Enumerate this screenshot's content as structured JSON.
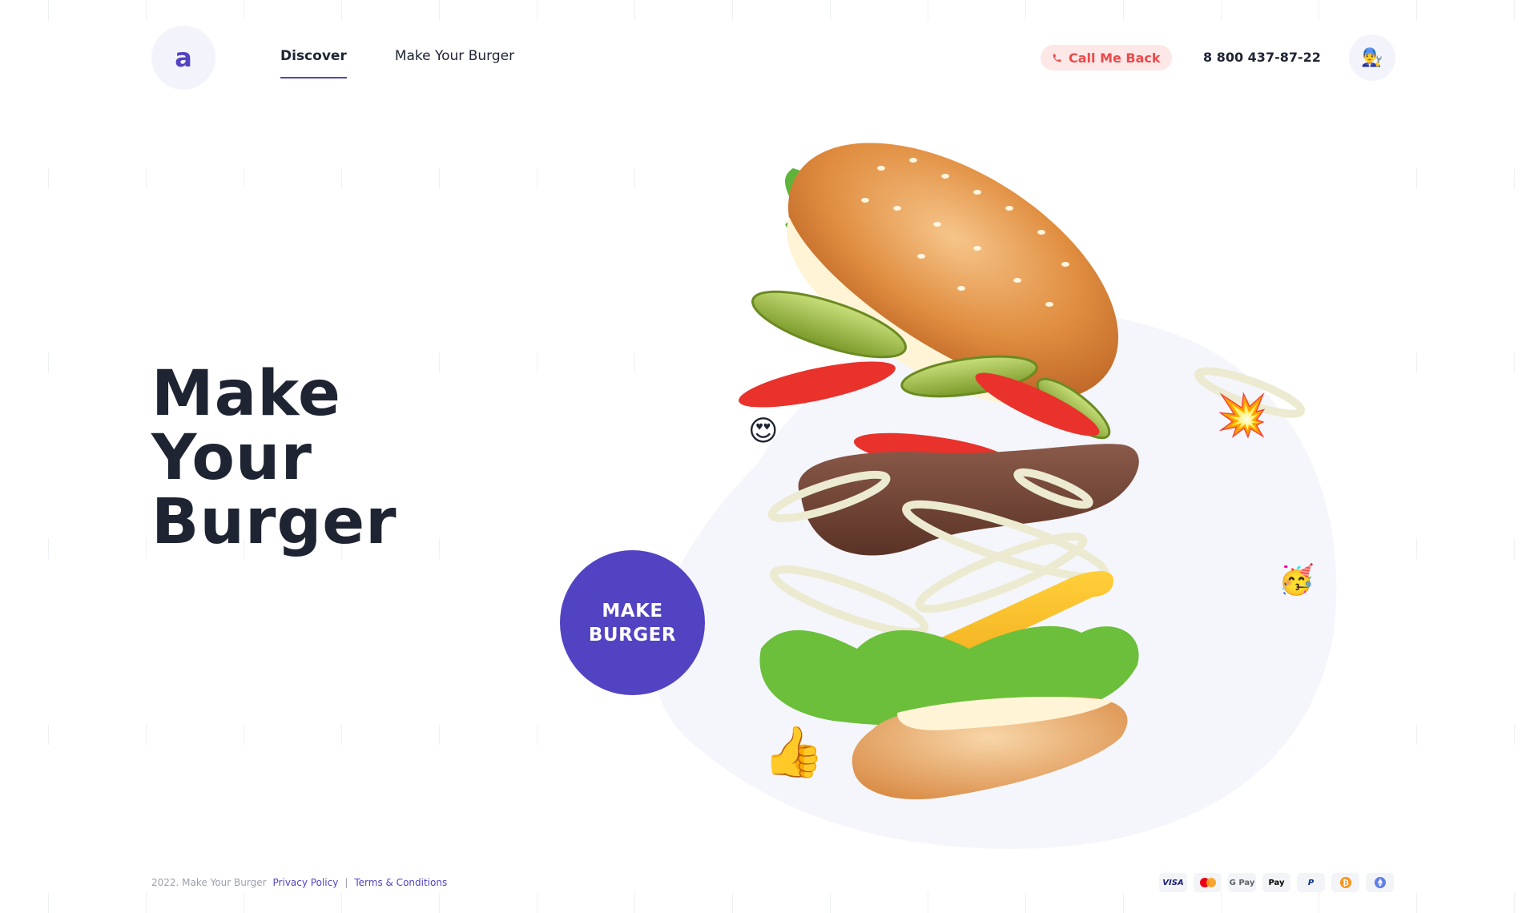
{
  "header": {
    "logo_letter": "a",
    "nav": [
      {
        "label": "Discover",
        "active": true
      },
      {
        "label": "Make Your Burger",
        "active": false
      }
    ],
    "callback_label": "Call Me Back",
    "phone": "8 800 437-87-22",
    "avatar_icon": "mechanic-emoji-icon"
  },
  "hero": {
    "title_lines": [
      "Make",
      "Your",
      "Burger"
    ],
    "cta_lines": [
      "MAKE",
      "BURGER"
    ]
  },
  "emojis": {
    "love": "😍",
    "party": "🥳",
    "thumbs": "👍",
    "boom": "💥",
    "avatar": "👨‍🔧"
  },
  "footer": {
    "copyright": "2022. Make Your Burger",
    "privacy": "Privacy Policy",
    "separator": "|",
    "terms": "Terms & Conditions",
    "payments": [
      "VISA",
      "mastercard",
      "G Pay",
      "Apple Pay",
      "PayPal",
      "bitcoin",
      "ethereum"
    ]
  },
  "colors": {
    "accent": "#5143c2",
    "text": "#1f2433",
    "callback_bg": "#fde7e7",
    "callback_text": "#ea4b4b",
    "blob": "#f5f6fb"
  }
}
